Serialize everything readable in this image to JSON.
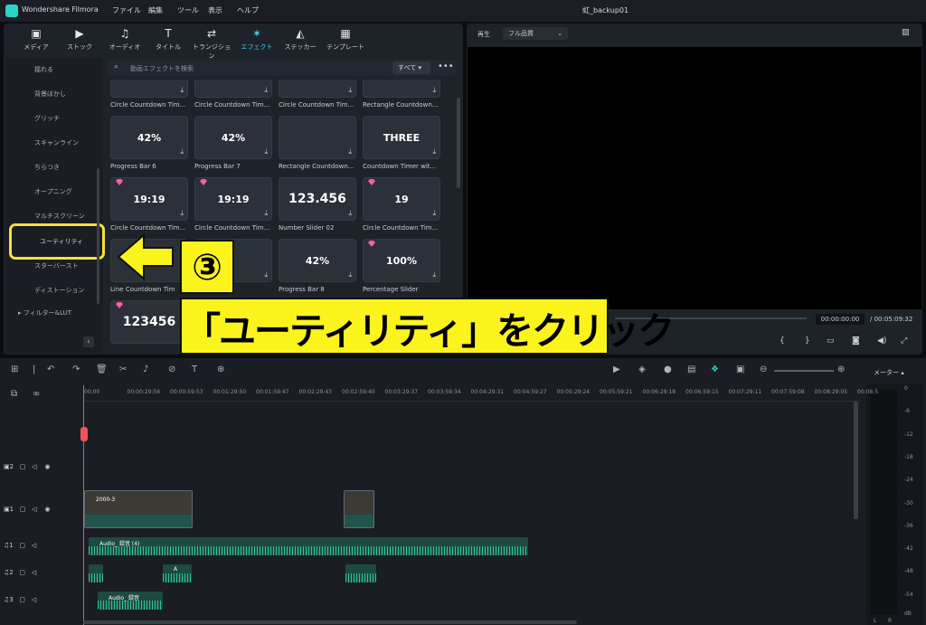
{
  "app": {
    "name": "Wondershare Filmora",
    "document": "虹_backup01"
  },
  "menu": [
    "ファイル",
    "編集",
    "ツール",
    "表示",
    "ヘルプ"
  ],
  "toolbar": [
    {
      "icon": "media-icon",
      "glyph": "▣",
      "label": "メディア"
    },
    {
      "icon": "stock-icon",
      "glyph": "▶",
      "label": "ストック"
    },
    {
      "icon": "audio-icon",
      "glyph": "♫",
      "label": "オーディオ"
    },
    {
      "icon": "title-icon",
      "glyph": "T",
      "label": "タイトル"
    },
    {
      "icon": "transition-icon",
      "glyph": "⇄",
      "label": "トランジション"
    },
    {
      "icon": "effect-icon",
      "glyph": "✶",
      "label": "エフェクト",
      "active": true
    },
    {
      "icon": "sticker-icon",
      "glyph": "◭",
      "label": "ステッカー"
    },
    {
      "icon": "template-icon",
      "glyph": "▦",
      "label": "テンプレート"
    }
  ],
  "categories": [
    "揺れる",
    "背景ぼかし",
    "グリッチ",
    "スキャンライン",
    "ちらつき",
    "オープニング",
    "マルチスクリーン",
    "ユーティリティ",
    "スターバースト",
    "ディストーション"
  ],
  "filter_lut": "フィルター&LUT",
  "search": {
    "placeholder": "動画エフェクトを検索",
    "filter": "すべて"
  },
  "effects": [
    {
      "label": "Circle Countdown Tim...",
      "preview": ""
    },
    {
      "label": "Circle Countdown Tim...",
      "preview": ""
    },
    {
      "label": "Circle Countdown Tim...",
      "preview": ""
    },
    {
      "label": "Rectangle Countdown...",
      "preview": ""
    },
    {
      "label": "Progress Bar 6",
      "preview": "42%"
    },
    {
      "label": "Progress Bar 7",
      "preview": "42%"
    },
    {
      "label": "Rectangle Countdown...",
      "preview": ""
    },
    {
      "label": "Countdown Timer wit...",
      "preview": "THREE"
    },
    {
      "label": "Circle Countdown Tim...",
      "preview": "19:19"
    },
    {
      "label": "Circle Countdown Tim...",
      "preview": "19:19"
    },
    {
      "label": "Number Slider 02",
      "preview": "123.456"
    },
    {
      "label": "Circle Countdown Tim...",
      "preview": "19"
    },
    {
      "label": "Line Countdown Tim",
      "preview": ""
    },
    {
      "label": "r 5",
      "preview": ""
    },
    {
      "label": "Progress Bar 8",
      "preview": "42%"
    },
    {
      "label": "Percentage Slider",
      "preview": "100%"
    },
    {
      "label": "",
      "preview": "123456"
    }
  ],
  "preview": {
    "play_label": "再生",
    "quality": "フル品質",
    "timecode": "00:00:00:00",
    "duration": "/ 00:05:09:32"
  },
  "annotation": {
    "step": "③",
    "text": "「ユーティリティ」をクリック"
  },
  "timeline": {
    "ticks": [
      "00:00",
      "00:00:29:56",
      "00:00:59:53",
      "00:01:29:50",
      "00:01:59:47",
      "00:02:29:43",
      "00:02:59:40",
      "00:03:29:37",
      "00:03:59:34",
      "00:04:29:31",
      "00:04:59:27",
      "00:05:29:24",
      "00:05:59:21",
      "00:06:29:18",
      "00:06:59:15",
      "00:07:29:11",
      "00:07:59:08",
      "00:08:29:05",
      "00:08:5"
    ],
    "tracks": [
      "2",
      "1",
      "1",
      "2",
      "3"
    ],
    "video_clip_label": "2000-3",
    "audio_main": "Audio_ 録音 (4)",
    "audio_a": "A",
    "audio_3": "Audio_ 録音"
  },
  "meter": {
    "title": "メーター",
    "db_labels": [
      "0",
      "-6",
      "-12",
      "-18",
      "-24",
      "-30",
      "-36",
      "-42",
      "-48",
      "-54"
    ],
    "db_unit": "dB",
    "channels": [
      "L",
      "R"
    ]
  }
}
